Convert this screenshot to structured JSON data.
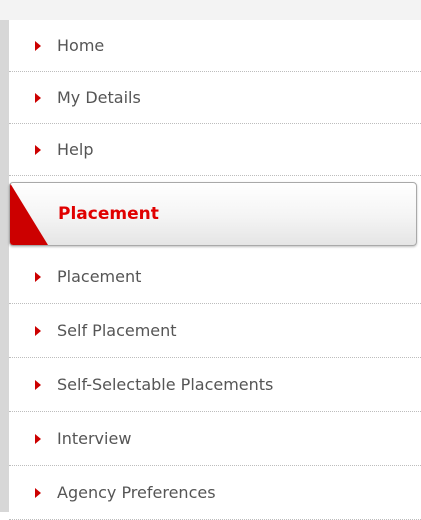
{
  "nav": {
    "top_items": [
      {
        "label": "Home"
      },
      {
        "label": "My Details"
      },
      {
        "label": "Help"
      }
    ],
    "section": {
      "title": "Placement"
    },
    "section_items": [
      {
        "label": "Placement"
      },
      {
        "label": "Self Placement"
      },
      {
        "label": "Self-Selectable Placements"
      },
      {
        "label": "Interview"
      },
      {
        "label": "Agency Preferences"
      }
    ]
  },
  "colors": {
    "accent": "#cc0000",
    "title_red": "#e00000",
    "text": "#555555"
  },
  "icons": {
    "item_icon": "right-triangle-arrow-icon",
    "section_corner": "red-corner-triangle-icon"
  }
}
